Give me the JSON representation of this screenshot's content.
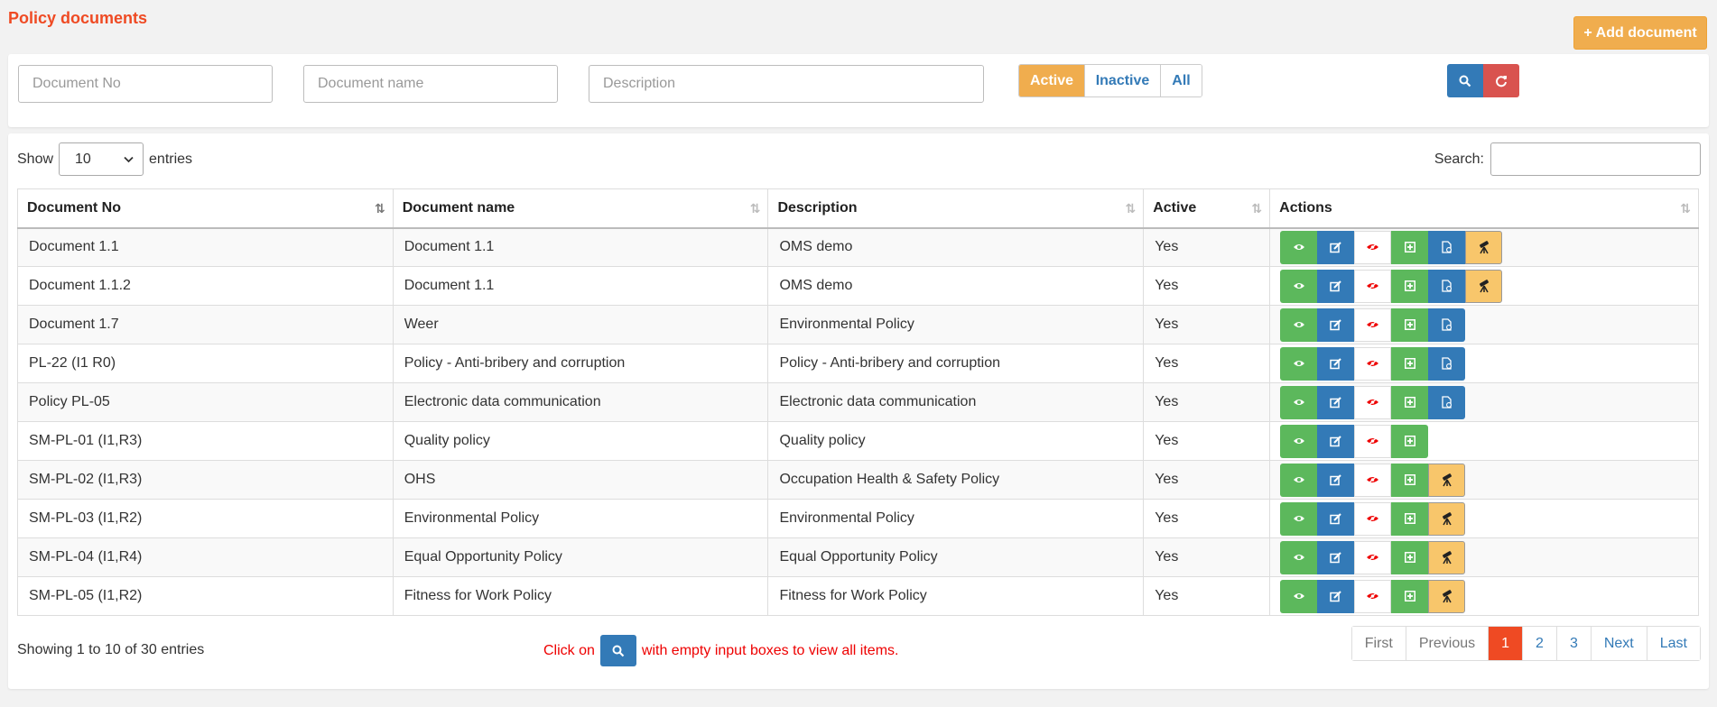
{
  "page": {
    "title": "Policy documents",
    "add_label": "Add document"
  },
  "filters": {
    "doc_no_placeholder": "Document No",
    "doc_name_placeholder": "Document name",
    "description_placeholder": "Description",
    "status_options": [
      "Active",
      "Inactive",
      "All"
    ],
    "selected_status": "Active"
  },
  "table_controls": {
    "show_label": "Show",
    "page_length": "10",
    "entries_label": "entries",
    "search_label": "Search:"
  },
  "columns": [
    "Document No",
    "Document name",
    "Description",
    "Active",
    "Actions"
  ],
  "rows": [
    {
      "doc_no": "Document 1.1",
      "name": "Document 1.1",
      "description": "OMS demo",
      "active": "Yes",
      "actions": [
        "view",
        "edit",
        "hide",
        "add",
        "doc",
        "scope"
      ]
    },
    {
      "doc_no": "Document 1.1.2",
      "name": "Document 1.1",
      "description": "OMS demo",
      "active": "Yes",
      "actions": [
        "view",
        "edit",
        "hide",
        "add",
        "doc",
        "scope"
      ]
    },
    {
      "doc_no": "Document 1.7",
      "name": "Weer",
      "description": "Environmental Policy",
      "active": "Yes",
      "actions": [
        "view",
        "edit",
        "hide",
        "add",
        "doc"
      ]
    },
    {
      "doc_no": "PL-22 (I1 R0)",
      "name": "Policy - Anti-bribery and corruption",
      "description": "Policy - Anti-bribery and corruption",
      "active": "Yes",
      "actions": [
        "view",
        "edit",
        "hide",
        "add",
        "doc"
      ]
    },
    {
      "doc_no": "Policy PL-05",
      "name": "Electronic data communication",
      "description": "Electronic data communication",
      "active": "Yes",
      "actions": [
        "view",
        "edit",
        "hide",
        "add",
        "doc"
      ]
    },
    {
      "doc_no": "SM-PL-01 (I1,R3)",
      "name": "Quality policy",
      "description": "Quality policy",
      "active": "Yes",
      "actions": [
        "view",
        "edit",
        "hide",
        "add"
      ]
    },
    {
      "doc_no": "SM-PL-02 (I1,R3)",
      "name": "OHS",
      "description": "Occupation Health & Safety Policy",
      "active": "Yes",
      "actions": [
        "view",
        "edit",
        "hide",
        "add",
        "scope"
      ]
    },
    {
      "doc_no": "SM-PL-03 (I1,R2)",
      "name": "Environmental Policy",
      "description": "Environmental Policy",
      "active": "Yes",
      "actions": [
        "view",
        "edit",
        "hide",
        "add",
        "scope"
      ]
    },
    {
      "doc_no": "SM-PL-04 (I1,R4)",
      "name": "Equal Opportunity Policy",
      "description": "Equal Opportunity Policy",
      "active": "Yes",
      "actions": [
        "view",
        "edit",
        "hide",
        "add",
        "scope"
      ]
    },
    {
      "doc_no": "SM-PL-05 (I1,R2)",
      "name": "Fitness for Work Policy",
      "description": "Fitness for Work Policy",
      "active": "Yes",
      "actions": [
        "view",
        "edit",
        "hide",
        "add",
        "scope"
      ]
    }
  ],
  "footer": {
    "info": "Showing 1 to 10 of 30 entries",
    "hint_before": "Click on",
    "hint_after": "with empty input boxes to view all items.",
    "pagination": [
      "First",
      "Previous",
      "1",
      "2",
      "3",
      "Next",
      "Last"
    ],
    "current_page": "1"
  },
  "icons": {
    "view": "eye-icon",
    "edit": "edit-icon",
    "hide": "eye-slash-icon",
    "add": "plus-square-icon",
    "doc": "document-icon",
    "scope": "telescope-icon",
    "search": "search-icon",
    "reset": "refresh-icon"
  },
  "colors": {
    "title": "#ef4a23",
    "warning": "#f0ad4e",
    "primary": "#337ab7",
    "success": "#5cb85c",
    "danger": "#d9534f",
    "hint": "#e00000"
  }
}
